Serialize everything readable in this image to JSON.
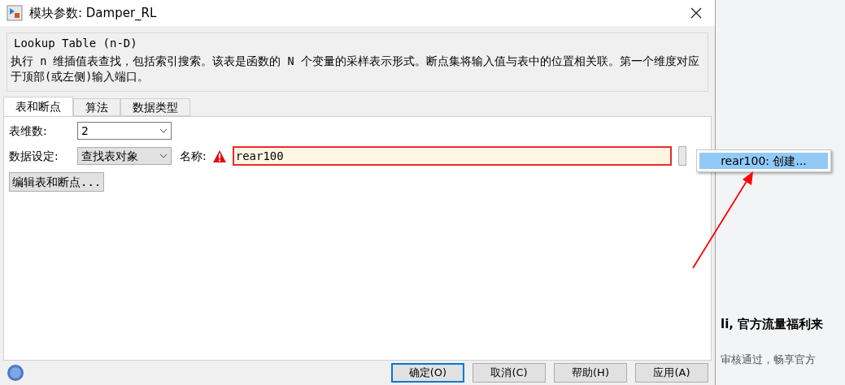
{
  "window": {
    "title": "模块参数: Damper_RL"
  },
  "block": {
    "name": "Lookup Table (n-D)",
    "description": "执行 n 维插值表查找，包括索引搜索。该表是函数的 N 个变量的采样表示形式。断点集将输入值与表中的位置相关联。第一个维度对应于顶部(或左侧)输入端口。"
  },
  "tabs": [
    {
      "label": "表和断点",
      "selected": true
    },
    {
      "label": "算法",
      "selected": false
    },
    {
      "label": "数据类型",
      "selected": false
    }
  ],
  "dimensions": {
    "label": "表维数:",
    "value": "2"
  },
  "data_spec": {
    "label": "数据设定:",
    "value": "查找表对象"
  },
  "name_field": {
    "label": "名称:",
    "value": "rear100",
    "error": true
  },
  "suggestion": {
    "label": "rear100: 创建...",
    "selected": true
  },
  "edit_button": "编辑表和断点...",
  "buttons": [
    {
      "label": "确定(O)",
      "default": true
    },
    {
      "label": "取消(C)",
      "default": false
    },
    {
      "label": "帮助(H)",
      "default": false
    },
    {
      "label": "应用(A)",
      "default": false
    }
  ],
  "background_page": {
    "heading": "li, 官方流量福利来",
    "text": "审核通过，畅享官方"
  }
}
